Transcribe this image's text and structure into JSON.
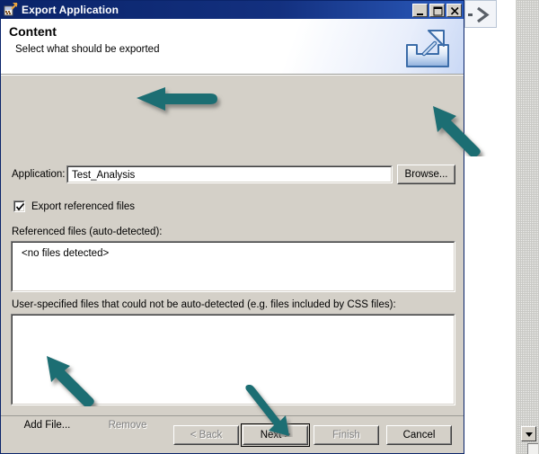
{
  "window": {
    "title": "Export Application",
    "icon": "export-app-icon",
    "controls": [
      {
        "name": "minimize",
        "glyph": "minimize-icon"
      },
      {
        "name": "maximize",
        "glyph": "maximize-icon"
      },
      {
        "name": "close",
        "glyph": "close-icon"
      }
    ]
  },
  "header": {
    "title": "Content",
    "subtitle": "Select what should be exported",
    "icon": "export-arrow-tray-icon"
  },
  "form": {
    "application_label": "Application:",
    "application_value": "Test_Analysis",
    "application_placeholder": "",
    "browse_label": "Browse...",
    "export_referenced_label": "Export referenced files",
    "export_referenced_checked": true,
    "referenced_files_label": "Referenced files (auto-detected):",
    "referenced_files_value": "<no files detected>",
    "user_files_label": "User-specified files that could not be auto-detected (e.g. files included by CSS files):",
    "user_files_value": "",
    "add_file_label": "Add File...",
    "remove_label": "Remove",
    "remove_disabled": true
  },
  "footer": {
    "back_label": "< Back",
    "back_disabled": true,
    "next_label": "Next >",
    "next_default": true,
    "finish_label": "Finish",
    "finish_disabled": true,
    "cancel_label": "Cancel"
  },
  "background": {
    "chevron_icon": "chevron-right-icon",
    "scroll_down_icon": "scroll-down-arrow-icon"
  },
  "annotations": {
    "color": "#1e6e73",
    "shadow_color": "#9a9a94",
    "arrows": [
      {
        "name": "arrow-to-application-field",
        "target": "application-input",
        "direction": "left"
      },
      {
        "name": "arrow-to-browse-button",
        "target": "browse-button",
        "direction": "up-left"
      },
      {
        "name": "arrow-to-add-file-button",
        "target": "add-file-button",
        "direction": "up-left"
      },
      {
        "name": "arrow-to-next-button",
        "target": "next-button",
        "direction": "down-right"
      }
    ]
  }
}
